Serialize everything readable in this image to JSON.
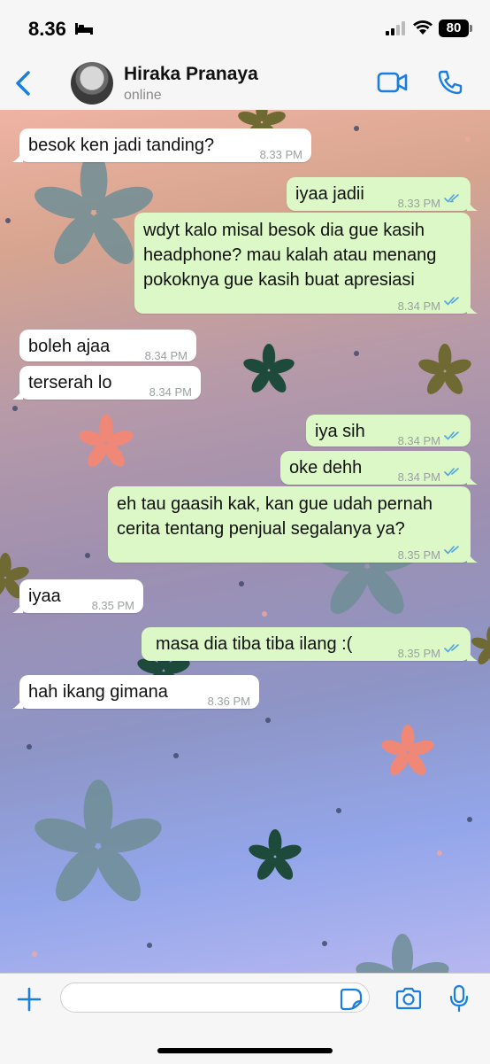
{
  "status_bar": {
    "time": "8.36",
    "battery": "80"
  },
  "header": {
    "contact_name": "Hiraka Pranaya",
    "contact_status": "online"
  },
  "messages": [
    {
      "direction": "in",
      "text": "besok ken jadi tanding?",
      "time": "8.33 PM"
    },
    {
      "direction": "out",
      "text": "iyaa jadii",
      "time": "8.33 PM",
      "read": true
    },
    {
      "direction": "out",
      "text": "wdyt kalo misal besok dia gue kasih\nheadphone? mau kalah atau menang\npokoknya gue kasih buat apresiasi",
      "time": "8.34 PM",
      "read": true
    },
    {
      "direction": "in",
      "text": "boleh ajaa",
      "time": "8.34 PM"
    },
    {
      "direction": "in",
      "text": "terserah lo",
      "time": "8.34 PM"
    },
    {
      "direction": "out",
      "text": "iya sih",
      "time": "8.34 PM",
      "read": true
    },
    {
      "direction": "out",
      "text": "oke dehh",
      "time": "8.34 PM",
      "read": true
    },
    {
      "direction": "out",
      "text": "eh tau gaasih kak, kan gue udah pernah\ncerita tentang penjual segalanya ya?",
      "time": "8.35 PM",
      "read": true
    },
    {
      "direction": "in",
      "text": "iyaa",
      "time": "8.35 PM"
    },
    {
      "direction": "out",
      "text": "masa dia tiba tiba ilang :(",
      "time": "8.35 PM",
      "read": true
    },
    {
      "direction": "in",
      "text": "hah ikang gimana",
      "time": "8.36 PM"
    }
  ],
  "input_bar": {
    "placeholder": ""
  },
  "colors": {
    "accent": "#1a7de0",
    "outgoing_bubble": "#dcf8c6",
    "incoming_bubble": "#ffffff",
    "read_ticks": "#4fa3e0"
  }
}
